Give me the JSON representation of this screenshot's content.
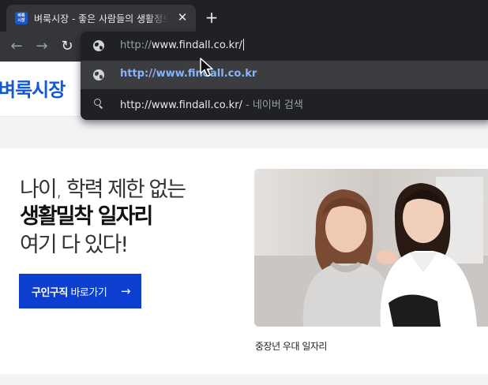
{
  "browser": {
    "tab": {
      "favicon_text": "벼룩\n시장",
      "title": "벼룩시장 - 좋은 사람들의 생활정보",
      "close_glyph": "✕"
    },
    "new_tab_glyph": "+",
    "nav": {
      "back_glyph": "←",
      "forward_glyph": "→",
      "reload_glyph": "↻"
    },
    "omnibox": {
      "input_scheme": "http://",
      "input_host": "www.findall.co.kr/",
      "suggestions": [
        {
          "icon": "globe-icon",
          "text": "http://www.findall.co.kr"
        },
        {
          "icon": "search-icon",
          "url": "http://www.findall.co.kr/",
          "separator": "-",
          "suffix": "네이버 검색"
        }
      ]
    }
  },
  "site": {
    "logo": "벼룩시장",
    "hero": {
      "line1": "나이, 학력 제한 없는",
      "line2": "생활밀착 일자리",
      "line3": "여기 다 있다!",
      "cta": {
        "bold": "구인구직",
        "rest": " 바로가기",
        "arrow": "→"
      },
      "photo_caption": "중장년 우대 일자리"
    }
  },
  "colors": {
    "chrome_dark": "#202124",
    "chrome_tab": "#35363a",
    "suggestion_highlight": "#3c3d40",
    "link_blue": "#8ab4f8",
    "brand_blue": "#1259d4",
    "cta_blue": "#0c3fd0"
  }
}
